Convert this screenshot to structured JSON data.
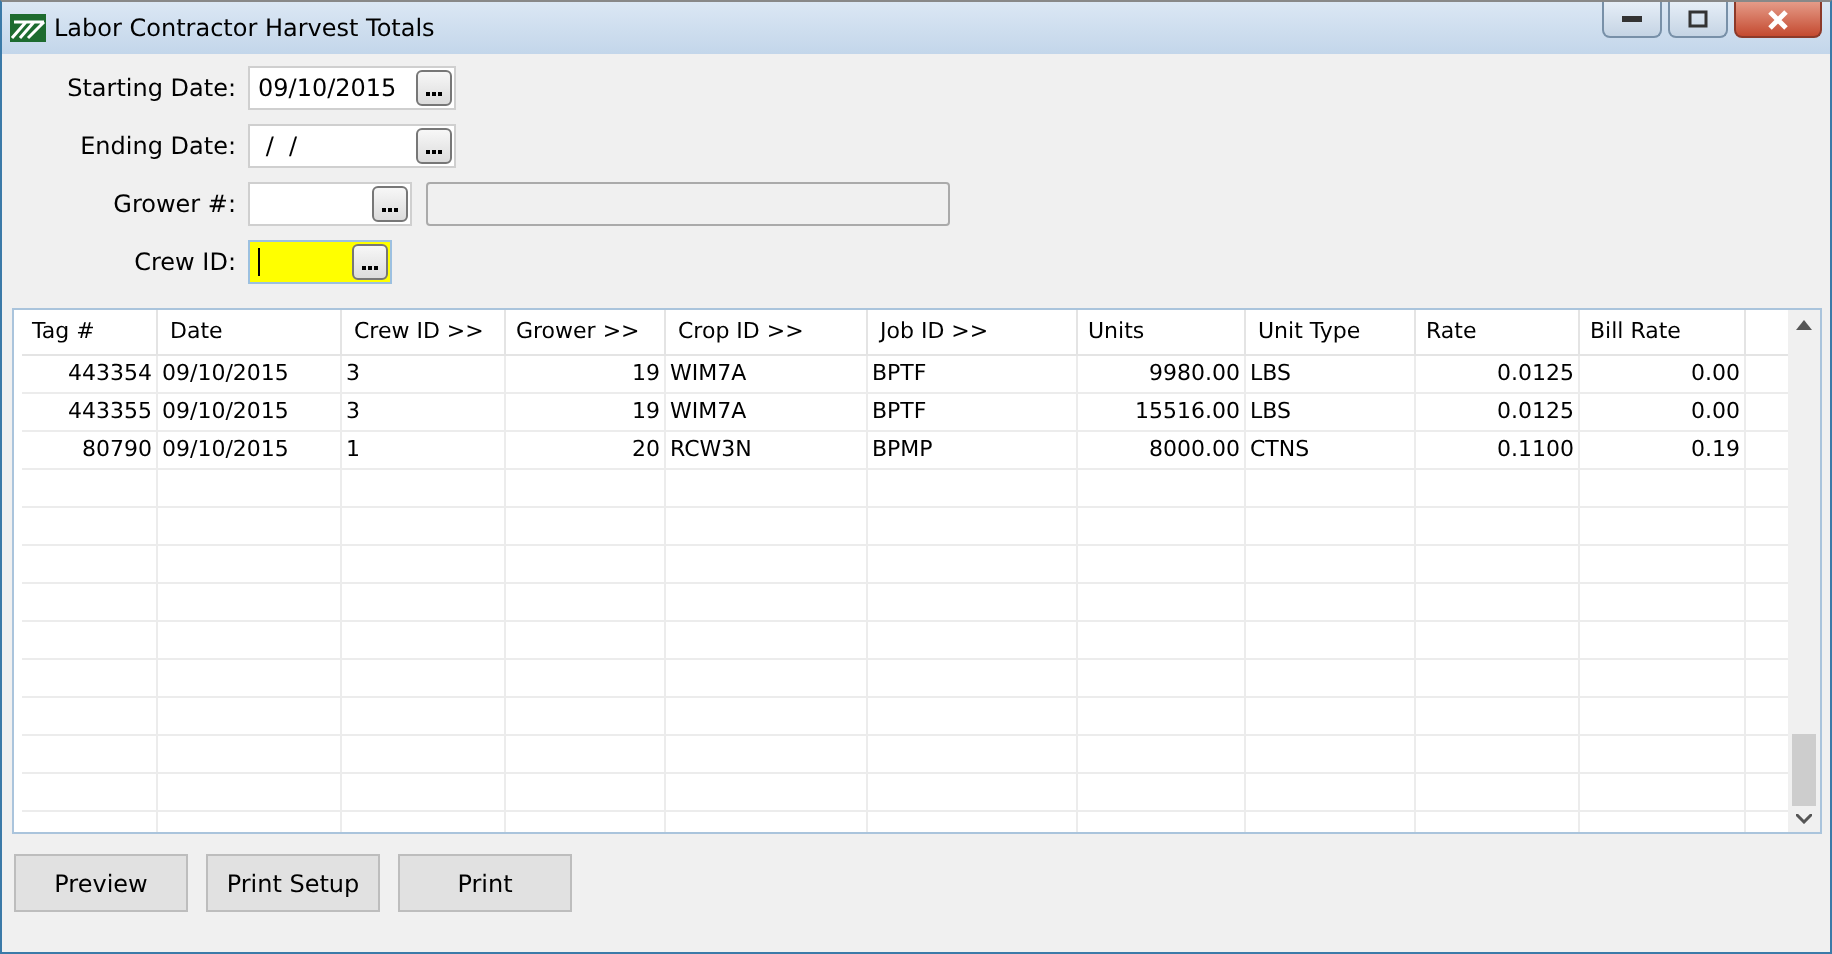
{
  "window": {
    "title": "Labor Contractor Harvest Totals"
  },
  "fields": [
    {
      "label": "Starting Date:",
      "value": "09/10/2015",
      "focused": false,
      "name_box": false
    },
    {
      "label": "Ending Date:",
      "value": " /  /",
      "focused": false,
      "name_box": false
    },
    {
      "label": "Grower #:",
      "focused": false,
      "name_box": true
    },
    {
      "label": "Crew ID:",
      "focused": true,
      "name_box": false
    }
  ],
  "table": {
    "columns": [
      {
        "label": "Tag #",
        "numeric": true
      },
      {
        "label": "Date",
        "numeric": false
      },
      {
        "label": "Crew ID >>",
        "numeric": false
      },
      {
        "label": "Grower >>",
        "numeric": true
      },
      {
        "label": "Crop ID >>",
        "numeric": false
      },
      {
        "label": "Job ID >>",
        "numeric": false
      },
      {
        "label": "Units",
        "numeric": true
      },
      {
        "label": "Unit Type",
        "numeric": false
      },
      {
        "label": "Rate",
        "numeric": true
      },
      {
        "label": "Bill Rate",
        "numeric": true
      }
    ],
    "rows": [
      [
        "443354",
        "09/10/2015",
        "3",
        "19",
        "WIM7A",
        "BPTF",
        "9980.00",
        "LBS",
        "0.0125",
        "0.00"
      ],
      [
        "443355",
        "09/10/2015",
        "3",
        "19",
        "WIM7A",
        "BPTF",
        "15516.00",
        "LBS",
        "0.0125",
        "0.00"
      ],
      [
        "80790",
        "09/10/2015",
        "1",
        "20",
        "RCW3N",
        "BPMP",
        "8000.00",
        "CTNS",
        "0.1100",
        "0.19"
      ]
    ]
  },
  "buttons": [
    "Preview",
    "Print Setup",
    "Print"
  ]
}
